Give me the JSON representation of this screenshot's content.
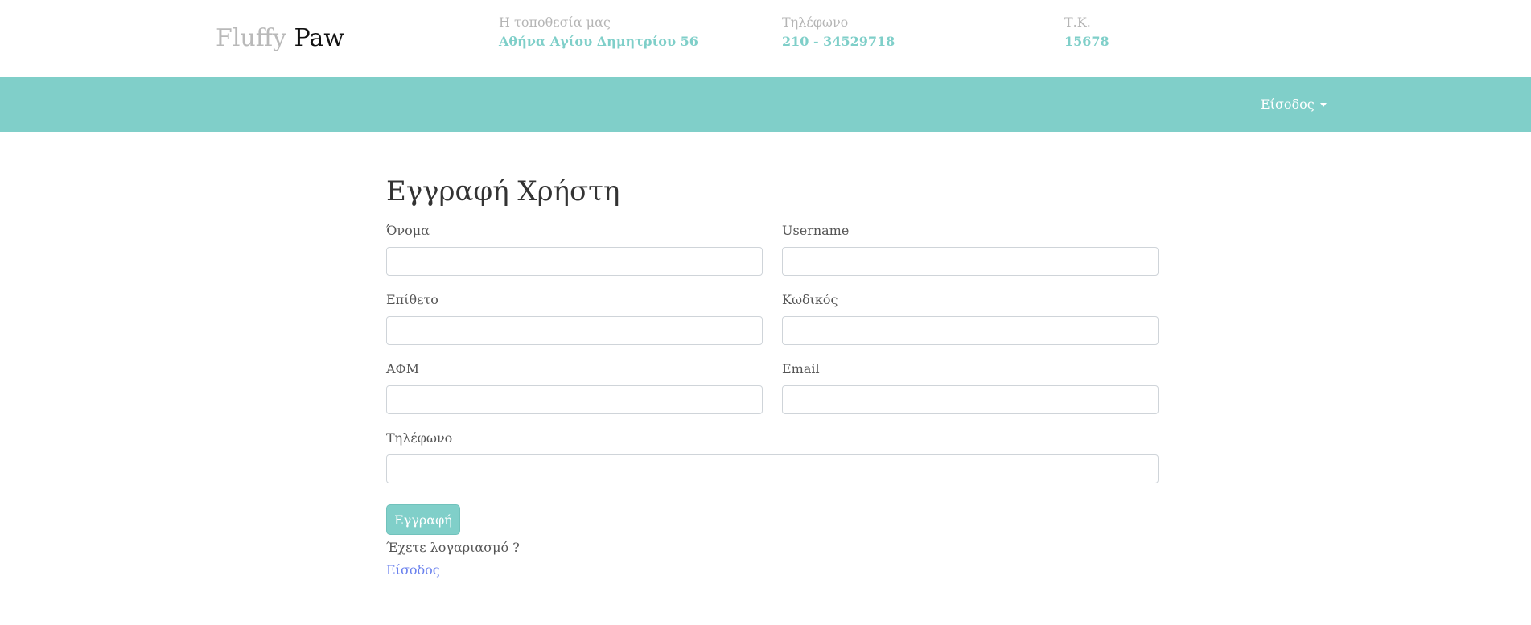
{
  "brand": {
    "light": "Fluffy",
    "dark": "Paw"
  },
  "contact": [
    {
      "label": "Η τοποθεσία μας",
      "value": "Αθήνα Αγίου Δημητρίου 56"
    },
    {
      "label": "Τηλέφωνο",
      "value": "210 - 34529718"
    },
    {
      "label": "Τ.Κ.",
      "value": "15678"
    }
  ],
  "nav": {
    "login_label": "Είσοδος"
  },
  "form": {
    "title": "Εγγραφή Χρήστη",
    "fields": {
      "first_name": {
        "label": "Όνομα",
        "value": ""
      },
      "username": {
        "label": "Username",
        "value": ""
      },
      "last_name": {
        "label": "Επίθετο",
        "value": ""
      },
      "password": {
        "label": "Κωδικός",
        "value": ""
      },
      "afm": {
        "label": "ΑΦΜ",
        "value": ""
      },
      "email": {
        "label": "Email",
        "value": ""
      },
      "phone": {
        "label": "Τηλέφωνο",
        "value": ""
      }
    },
    "submit_label": "Εγγραφή",
    "have_account": "Έχετε λογαριασμό ?",
    "login_link": "Είσοδος"
  },
  "colors": {
    "accent": "#80cfc9",
    "link": "#6b82ee"
  }
}
